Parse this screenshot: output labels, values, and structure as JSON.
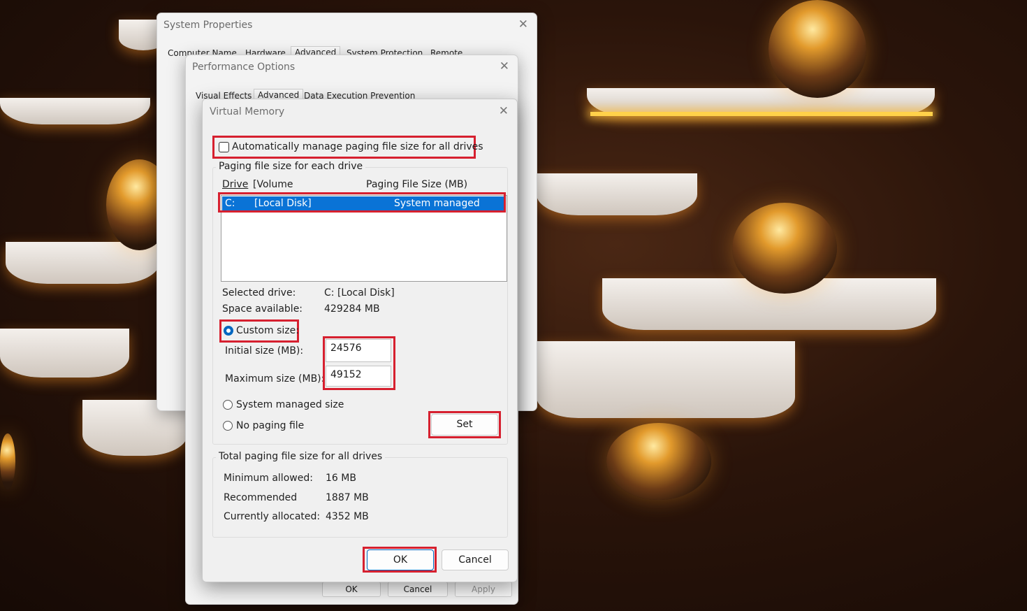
{
  "system_properties": {
    "title": "System Properties",
    "tabs": [
      "Computer Name",
      "Hardware",
      "Advanced",
      "System Protection",
      "Remote"
    ],
    "buttons": {
      "ok": "OK",
      "cancel": "Cancel",
      "apply": "Apply"
    }
  },
  "performance_options": {
    "title": "Performance Options",
    "tabs": [
      "Visual Effects",
      "Advanced",
      "Data Execution Prevention"
    ]
  },
  "virtual_memory": {
    "title": "Virtual Memory",
    "auto_manage_label": "Automatically manage paging file size for all drives",
    "auto_manage_checked": false,
    "group_drive_label": "Paging file size for each drive",
    "columns": {
      "drive": "Drive",
      "volume": "[Volume",
      "size": "Paging File Size (MB)"
    },
    "drives": [
      {
        "drive": "C:",
        "volume": "[Local Disk]",
        "size": "System managed"
      }
    ],
    "selected_drive_label": "Selected drive:",
    "selected_drive_value": "C:  [Local Disk]",
    "space_available_label": "Space available:",
    "space_available_value": "429284 MB",
    "custom_size_label": "Custom size:",
    "initial_size_label": "Initial size (MB):",
    "initial_size_value": "24576",
    "maximum_size_label": "Maximum size (MB):",
    "maximum_size_value": "49152",
    "system_managed_label": "System managed size",
    "no_paging_label": "No paging file",
    "set_button": "Set",
    "total_group_label": "Total paging file size for all drives",
    "minimum_allowed_label": "Minimum allowed:",
    "minimum_allowed_value": "16 MB",
    "recommended_label": "Recommended",
    "recommended_value": "1887 MB",
    "currently_allocated_label": "Currently allocated:",
    "currently_allocated_value": "4352 MB",
    "ok_button": "OK",
    "cancel_button": "Cancel"
  },
  "colors": {
    "highlight": "#d6202f",
    "selection": "#0a73d6"
  }
}
